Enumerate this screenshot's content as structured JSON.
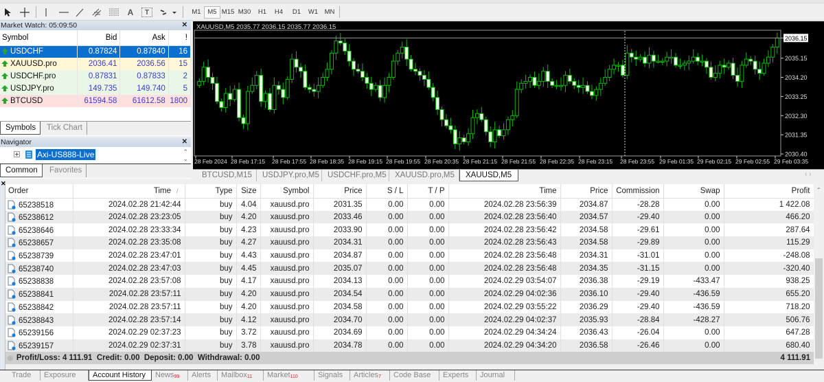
{
  "toolbar": {
    "tools": [
      {
        "name": "cursor-tool",
        "icon": "arrow-cursor-icon"
      },
      {
        "name": "crosshair-tool",
        "icon": "crosshair-icon"
      },
      {
        "name": "vertical-line-tool",
        "icon": "vertical-line-icon"
      },
      {
        "name": "horizontal-line-tool",
        "icon": "horizontal-line-icon"
      },
      {
        "name": "trendline-tool",
        "icon": "trendline-icon"
      },
      {
        "name": "equidistant-channel-tool",
        "icon": "channel-icon"
      },
      {
        "name": "fibonacci-tool",
        "icon": "fibonacci-icon"
      },
      {
        "name": "text-tool",
        "icon": "text-icon",
        "label": "A"
      },
      {
        "name": "text-label-tool",
        "icon": "text-label-icon",
        "label": "T"
      },
      {
        "name": "shapes-dropdown",
        "icon": "shapes-icon"
      }
    ],
    "timeframes": [
      "M1",
      "M5",
      "M15",
      "M30",
      "H1",
      "H4",
      "D1",
      "W1",
      "MN"
    ],
    "active_timeframe": "M5"
  },
  "market_watch": {
    "title": "Market Watch: 05:09:50",
    "columns": [
      "Symbol",
      "Bid",
      "Ask",
      "!"
    ],
    "rows": [
      {
        "symbol": "USDCHF",
        "bid": "0.87824",
        "ask": "0.87840",
        "spread": "16",
        "bg": "#0b6fd0",
        "selected": true
      },
      {
        "symbol": "XAUUSD.pro",
        "bid": "2036.41",
        "ask": "2036.56",
        "spread": "15",
        "bg": "#fff7d6"
      },
      {
        "symbol": "USDCHF.pro",
        "bid": "0.87831",
        "ask": "0.87833",
        "spread": "2",
        "bg": "#eaf7e6"
      },
      {
        "symbol": "USDJPY.pro",
        "bid": "149.735",
        "ask": "149.740",
        "spread": "5",
        "bg": "#eaf7e6"
      },
      {
        "symbol": "BTCUSD",
        "bid": "61594.58",
        "ask": "61612.58",
        "spread": "1800",
        "bg": "#fde0df"
      }
    ],
    "tabs": [
      "Symbols",
      "Tick Chart"
    ],
    "active_tab": "Symbols"
  },
  "navigator": {
    "title": "Navigator",
    "account": "Axi-US888-Live",
    "tabs": [
      "Common",
      "Favorites"
    ],
    "active_tab": "Common"
  },
  "chart": {
    "header": "XAUUSD,M5  2035.77 2036.15 2035.77 2036.15",
    "current_price": "2036.15",
    "chart_tabs": [
      "BTCUSD,M15",
      "USDJPY.pro,M5",
      "USDCHF.pro,M5",
      "XAUUSD.pro,M5",
      "XAUUSD,M5"
    ],
    "active_chart_tab": "XAUUSD,M5",
    "colors": {
      "background": "#000000",
      "bull": "#00c000",
      "bear_fill": "#e8ffe0",
      "axis": "#c8c8c8"
    }
  },
  "chart_data": {
    "type": "candlestick",
    "title": "XAUUSD,M5",
    "ohlc_header": {
      "open": 2035.77,
      "high": 2036.15,
      "low": 2035.77,
      "close": 2036.15
    },
    "y_ticks": [
      "2036.15",
      "2035.15",
      "2034.20",
      "2033.25",
      "2032.30",
      "2031.35",
      "2030.40"
    ],
    "ylim": [
      2030.3,
      2036.5
    ],
    "x_ticks": [
      "28 Feb 2024",
      "28 Feb 17:15",
      "28 Feb 17:55",
      "28 Feb 18:35",
      "28 Feb 19:15",
      "28 Feb 19:55",
      "28 Feb 20:35",
      "28 Feb 21:15",
      "28 Feb 21:55",
      "28 Feb 22:35",
      "28 Feb 23:15",
      "28 Feb 23:55",
      "29 Feb 01:35",
      "29 Feb 02:15",
      "29 Feb 02:55",
      "29 Feb 03:35"
    ],
    "period_separator_at": "28 Feb 23:55",
    "closes": [
      2034.0,
      2034.7,
      2034.2,
      2033.9,
      2033.0,
      2032.7,
      2033.4,
      2033.1,
      2033.6,
      2032.2,
      2031.9,
      2033.5,
      2033.8,
      2034.3,
      2033.0,
      2033.4,
      2032.6,
      2033.8,
      2033.6,
      2033.2,
      2034.1,
      2035.1,
      2034.7,
      2034.5,
      2033.7,
      2033.6,
      2033.5,
      2033.8,
      2034.2,
      2034.6,
      2035.4,
      2036.0,
      2035.9,
      2035.5,
      2035.0,
      2034.6,
      2034.5,
      2034.2,
      2033.9,
      2033.6,
      2033.8,
      2033.2,
      2033.8,
      2034.2,
      2035.0,
      2035.4,
      2035.7,
      2035.1,
      2034.6,
      2034.5,
      2034.3,
      2034.1,
      2033.7,
      2033.2,
      2032.6,
      2032.1,
      2031.8,
      2031.6,
      2030.9,
      2031.2,
      2031.0,
      2031.4,
      2032.2,
      2032.4,
      2032.1,
      2031.5,
      2031.0,
      2031.6,
      2031.3,
      2031.6,
      2032.1,
      2032.3,
      2033.6,
      2033.9,
      2034.0,
      2034.2,
      2033.8,
      2034.0,
      2034.5,
      2034.0,
      2033.8,
      2033.8,
      2033.8,
      2034.3,
      2034.0,
      2033.8,
      2033.7,
      2033.8,
      2033.5,
      2033.3,
      2033.6,
      2033.9,
      2034.2,
      2034.6,
      2034.8,
      2034.8,
      2034.3,
      2035.4,
      2035.2,
      2035.1,
      2035.2,
      2034.9,
      2035.3,
      2035.0,
      2035.0,
      2035.0,
      2035.2,
      2035.2,
      2034.8,
      2034.8,
      2034.9,
      2035.0,
      2035.2,
      2035.0,
      2035.0,
      2034.7,
      2034.2,
      2034.4,
      2034.8,
      2034.7,
      2034.9,
      2034.3,
      2034.0,
      2034.8,
      2035.1,
      2035.0,
      2034.6,
      2034.4,
      2034.9,
      2035.2,
      2035.7,
      2036.15
    ]
  },
  "account_history": {
    "columns": [
      "Order",
      "Time",
      "Type",
      "Size",
      "Symbol",
      "Price",
      "S / L",
      "T / P",
      "Time",
      "Price",
      "Commission",
      "Swap",
      "Profit"
    ],
    "sort_indicator": "/",
    "rows": [
      [
        "65238518",
        "2024.02.28 21:42:44",
        "buy",
        "4.04",
        "xauusd.pro",
        "2031.35",
        "0.00",
        "0.00",
        "2024.02.28 23:56:39",
        "2034.87",
        "-28.28",
        "0.00",
        "1 422.08"
      ],
      [
        "65238612",
        "2024.02.28 23:23:05",
        "buy",
        "4.20",
        "xauusd.pro",
        "2033.46",
        "0.00",
        "0.00",
        "2024.02.28 23:56:40",
        "2034.57",
        "-29.40",
        "0.00",
        "466.20"
      ],
      [
        "65238646",
        "2024.02.28 23:33:34",
        "buy",
        "4.23",
        "xauusd.pro",
        "2033.90",
        "0.00",
        "0.00",
        "2024.02.28 23:56:42",
        "2034.58",
        "-29.61",
        "0.00",
        "287.64"
      ],
      [
        "65238657",
        "2024.02.28 23:35:08",
        "buy",
        "4.27",
        "xauusd.pro",
        "2034.31",
        "0.00",
        "0.00",
        "2024.02.28 23:56:43",
        "2034.58",
        "-29.89",
        "0.00",
        "115.29"
      ],
      [
        "65238739",
        "2024.02.28 23:47:01",
        "buy",
        "4.43",
        "xauusd.pro",
        "2034.87",
        "0.00",
        "0.00",
        "2024.02.28 23:56:48",
        "2034.31",
        "-31.01",
        "0.00",
        "-248.08"
      ],
      [
        "65238740",
        "2024.02.28 23:47:03",
        "buy",
        "4.45",
        "xauusd.pro",
        "2035.07",
        "0.00",
        "0.00",
        "2024.02.28 23:56:48",
        "2034.35",
        "-31.15",
        "0.00",
        "-320.40"
      ],
      [
        "65238838",
        "2024.02.28 23:57:08",
        "buy",
        "4.17",
        "xauusd.pro",
        "2034.13",
        "0.00",
        "0.00",
        "2024.02.29 03:54:07",
        "2036.38",
        "-29.19",
        "-433.47",
        "938.25"
      ],
      [
        "65238841",
        "2024.02.28 23:57:11",
        "buy",
        "4.20",
        "xauusd.pro",
        "2034.54",
        "0.00",
        "0.00",
        "2024.02.29 04:02:36",
        "2036.10",
        "-29.40",
        "-436.59",
        "655.20"
      ],
      [
        "65238842",
        "2024.02.28 23:57:11",
        "buy",
        "4.20",
        "xauusd.pro",
        "2034.58",
        "0.00",
        "0.00",
        "2024.02.29 03:55:22",
        "2036.29",
        "-29.40",
        "-436.59",
        "718.20"
      ],
      [
        "65238843",
        "2024.02.28 23:57:14",
        "buy",
        "4.12",
        "xauusd.pro",
        "2034.70",
        "0.00",
        "0.00",
        "2024.02.29 04:02:37",
        "2035.93",
        "-28.84",
        "-428.27",
        "506.76"
      ],
      [
        "65239156",
        "2024.02.29 02:37:23",
        "buy",
        "3.72",
        "xauusd.pro",
        "2034.69",
        "0.00",
        "0.00",
        "2024.02.29 04:34:24",
        "2036.43",
        "-26.04",
        "0.00",
        "647.28"
      ],
      [
        "65239157",
        "2024.02.29 02:37:31",
        "buy",
        "3.78",
        "xauusd.pro",
        "2034.78",
        "0.00",
        "0.00",
        "2024.02.29 04:34:20",
        "2036.58",
        "-26.46",
        "0.00",
        "680.40"
      ]
    ],
    "summary": {
      "text": "Profit/Loss: 4 111.91  Credit: 0.00  Deposit: 0.00  Withdrawal: 0.00",
      "total": "4 111.91"
    }
  },
  "terminal_tabs": [
    {
      "label": "Trade"
    },
    {
      "label": "Exposure"
    },
    {
      "label": "Account History",
      "active": true
    },
    {
      "label": "News",
      "badge": "99"
    },
    {
      "label": "Alerts"
    },
    {
      "label": "Mailbox",
      "badge": "11"
    },
    {
      "label": "Market",
      "badge": "110"
    },
    {
      "label": "Signals"
    },
    {
      "label": "Articles",
      "badge": "7"
    },
    {
      "label": "Code Base"
    },
    {
      "label": "Experts"
    },
    {
      "label": "Journal"
    }
  ]
}
